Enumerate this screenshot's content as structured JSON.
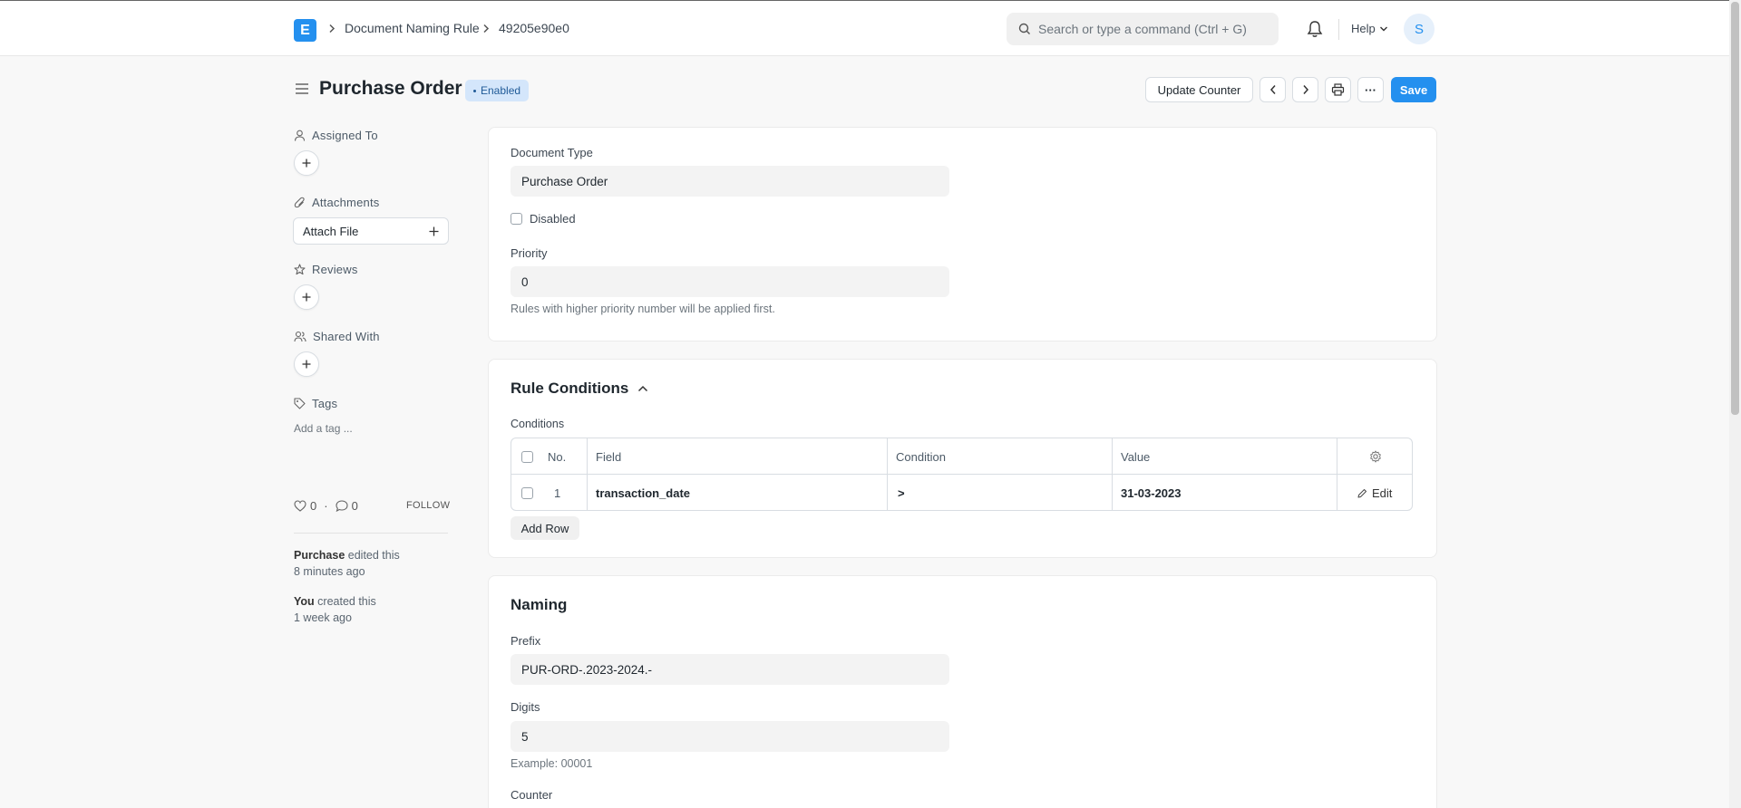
{
  "navbar": {
    "logo_letter": "E",
    "breadcrumbs": [
      "Document Naming Rule",
      "49205e90e0"
    ],
    "search_placeholder": "Search or type a command (Ctrl + G)",
    "help_label": "Help",
    "avatar_initial": "S"
  },
  "page": {
    "title": "Purchase Order",
    "status_badge": "Enabled",
    "actions": {
      "update_counter": "Update Counter",
      "prev": "‹",
      "next": "›",
      "more": "···",
      "save": "Save"
    }
  },
  "sidebar": {
    "assigned_to": "Assigned To",
    "attachments": "Attachments",
    "attach_file": "Attach File",
    "reviews": "Reviews",
    "shared_with": "Shared With",
    "tags": "Tags",
    "add_tag": "Add a tag ...",
    "likes": "0",
    "comments": "0",
    "separator": "·",
    "follow": "FOLLOW",
    "activity": [
      {
        "actor": "Purchase",
        "action": "edited this",
        "time": "8 minutes ago"
      },
      {
        "actor": "You",
        "action": "created this",
        "time": "1 week ago"
      }
    ]
  },
  "details": {
    "document_type_label": "Document Type",
    "document_type_value": "Purchase Order",
    "disabled_label": "Disabled",
    "priority_label": "Priority",
    "priority_value": "0",
    "priority_help": "Rules with higher priority number will be applied first."
  },
  "rule_conditions": {
    "title": "Rule Conditions",
    "conditions_label": "Conditions",
    "columns": [
      "No.",
      "Field",
      "Condition",
      "Value"
    ],
    "rows": [
      {
        "no": "1",
        "field": "transaction_date",
        "condition": ">",
        "value": "31-03-2023",
        "edit": "Edit"
      }
    ],
    "add_row": "Add Row"
  },
  "naming": {
    "title": "Naming",
    "prefix_label": "Prefix",
    "prefix_value": "PUR-ORD-.2023-2024.-",
    "digits_label": "Digits",
    "digits_value": "5",
    "digits_help": "Example: 00001",
    "counter_label": "Counter"
  },
  "colors": {
    "primary": "#2490ef",
    "badge_bg": "#d4e6fb",
    "badge_text": "#1f5a97"
  }
}
